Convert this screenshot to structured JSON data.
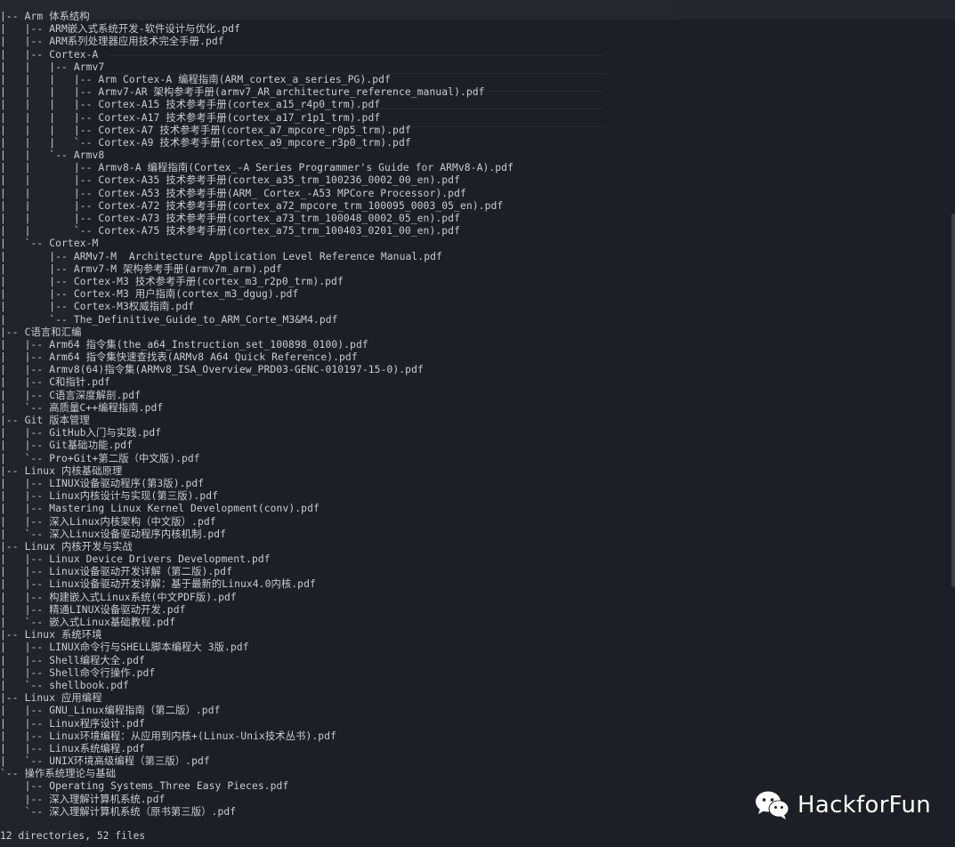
{
  "tree_lines": [
    "|-- Arm 体系结构",
    "|   |-- ARM嵌入式系统开发-软件设计与优化.pdf",
    "|   |-- ARM系列处理器应用技术完全手册.pdf",
    "|   |-- Cortex-A",
    "|   |   |-- Armv7",
    "|   |   |   |-- Arm Cortex-A 编程指南(ARM_cortex_a_series_PG).pdf",
    "|   |   |   |-- Armv7-AR 架构参考手册(armv7_AR_architecture_reference_manual).pdf",
    "|   |   |   |-- Cortex-A15 技术参考手册(cortex_a15_r4p0_trm).pdf",
    "|   |   |   |-- Cortex-A17 技术参考手册(cortex_a17_r1p1_trm).pdf",
    "|   |   |   |-- Cortex-A7 技术参考手册(cortex_a7_mpcore_r0p5_trm).pdf",
    "|   |   |   `-- Cortex-A9 技术参考手册(cortex_a9_mpcore_r3p0_trm).pdf",
    "|   |   `-- Armv8",
    "|   |       |-- Armv8-A 编程指南(Cortex_-A Series Programmer's Guide for ARMv8-A).pdf",
    "|   |       |-- Cortex-A35 技术参考手册(cortex_a35_trm_100236_0002_00_en).pdf",
    "|   |       |-- Cortex-A53 技术参考手册(ARM_ Cortex_-A53 MPCore Processor).pdf",
    "|   |       |-- Cortex-A72 技术参考手册(cortex_a72_mpcore_trm_100095_0003_05_en).pdf",
    "|   |       |-- Cortex-A73 技术参考手册(cortex_a73_trm_100048_0002_05_en).pdf",
    "|   |       `-- Cortex-A75 技术参考手册(cortex_a75_trm_100403_0201_00_en).pdf",
    "|   `-- Cortex-M",
    "|       |-- ARMv7-M  Architecture Application Level Reference Manual.pdf",
    "|       |-- Armv7-M 架构参考手册(armv7m_arm).pdf",
    "|       |-- Cortex-M3 技术参考手册(cortex_m3_r2p0_trm).pdf",
    "|       |-- Cortex-M3 用户指南(cortex_m3_dgug).pdf",
    "|       |-- Cortex-M3权威指南.pdf",
    "|       `-- The_Definitive_Guide_to_ARM_Corte_M3&M4.pdf",
    "|-- C语言和汇编",
    "|   |-- Arm64 指令集(the_a64_Instruction_set_100898_0100).pdf",
    "|   |-- Arm64 指令集快速查找表(ARMv8 A64 Quick Reference).pdf",
    "|   |-- Armv8(64)指令集(ARMv8_ISA_Overview_PRD03-GENC-010197-15-0).pdf",
    "|   |-- C和指针.pdf",
    "|   |-- C语言深度解剖.pdf",
    "|   `-- 高质量C++编程指南.pdf",
    "|-- Git 版本管理",
    "|   |-- GitHub入门与实践.pdf",
    "|   |-- Git基础功能.pdf",
    "|   `-- Pro+Git+第二版（中文版).pdf",
    "|-- Linux 内核基础原理",
    "|   |-- LINUX设备驱动程序(第3版).pdf",
    "|   |-- Linux内核设计与实现(第三版).pdf",
    "|   |-- Mastering Linux Kernel Development(conv).pdf",
    "|   |-- 深入Linux内核架构（中文版）.pdf",
    "|   `-- 深入Linux设备驱动程序内核机制.pdf",
    "|-- Linux 内核开发与实战",
    "|   |-- Linux Device Drivers Development.pdf",
    "|   |-- Linux设备驱动开发详解（第二版).pdf",
    "|   |-- Linux设备驱动开发详解：基于最新的Linux4.0内核.pdf",
    "|   |-- 构建嵌入式Linux系统(中文PDF版).pdf",
    "|   |-- 精通LINUX设备驱动开发.pdf",
    "|   `-- 嵌入式Linux基础教程.pdf",
    "|-- Linux 系统环境",
    "|   |-- LINUX命令行与SHELL脚本编程大 3版.pdf",
    "|   |-- Shell编程大全.pdf",
    "|   |-- Shell命令行操作.pdf",
    "|   `-- shellbook.pdf",
    "|-- Linux 应用编程",
    "|   |-- GNU_Linux编程指南（第二版）.pdf",
    "|   |-- Linux程序设计.pdf",
    "|   |-- Linux环境编程：从应用到内核+(Linux-Unix技术丛书).pdf",
    "|   |-- Linux系统编程.pdf",
    "|   `-- UNIX环境高级编程（第三版）.pdf",
    "`-- 操作系统理论与基础",
    "    |-- Operating Systems_Three Easy Pieces.pdf",
    "    |-- 深入理解计算机系统.pdf",
    "    `-- 深入理解计算机系统（原书第三版）.pdf"
  ],
  "summary": "12 directories, 52 files",
  "watermark": {
    "icon": "wechat-icon",
    "label": "HackforFun"
  },
  "colors": {
    "background": "#1c1f25",
    "text": "#c9ccd1",
    "watermark": "#ffffff"
  }
}
